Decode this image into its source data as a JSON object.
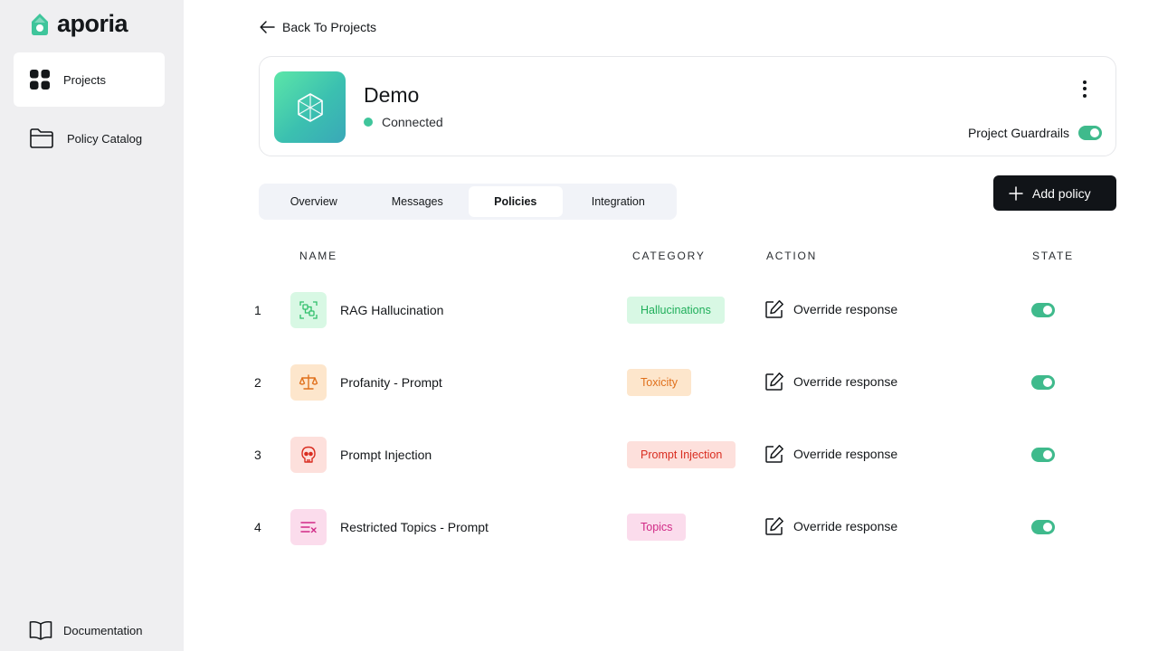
{
  "sidebar": {
    "logo_text": "aporia",
    "items": [
      {
        "label": "Projects",
        "icon": "grid-icon",
        "active": true
      },
      {
        "label": "Policy Catalog",
        "icon": "folder-icon",
        "active": false
      }
    ],
    "footer_item": {
      "label": "Documentation",
      "icon": "book-icon"
    }
  },
  "header": {
    "back_label": "Back To Projects"
  },
  "project": {
    "name": "Demo",
    "status": "Connected",
    "status_color": "#3fc59b",
    "guardrails_label": "Project Guardrails",
    "guardrails_enabled": true
  },
  "tabs": [
    {
      "label": "Overview",
      "active": false
    },
    {
      "label": "Messages",
      "active": false
    },
    {
      "label": "Policies",
      "active": true
    },
    {
      "label": "Integration",
      "active": false
    }
  ],
  "add_policy_label": "Add policy",
  "table": {
    "columns": [
      "NAME",
      "CATEGORY",
      "ACTION",
      "STATE"
    ],
    "rows": [
      {
        "num": "1",
        "name": "RAG Hallucination",
        "icon": "scan-icon",
        "category": "Hallucinations",
        "action": "Override response",
        "enabled": true
      },
      {
        "num": "2",
        "name": "Profanity - Prompt",
        "icon": "scale-icon",
        "category": "Toxicity",
        "action": "Override response",
        "enabled": true
      },
      {
        "num": "3",
        "name": "Prompt Injection",
        "icon": "skull-icon",
        "category": "Prompt Injection",
        "action": "Override response",
        "enabled": true
      },
      {
        "num": "4",
        "name": "Restricted Topics - Prompt",
        "icon": "list-x-icon",
        "category": "Topics",
        "action": "Override response",
        "enabled": true
      }
    ]
  },
  "colors": {
    "accent": "#3fba8c",
    "hallucinations_bg": "#d8f8e4",
    "hallucinations_fg": "#1fae5a",
    "toxicity_bg": "#fde6cc",
    "toxicity_fg": "#e0701c",
    "injection_bg": "#fde0dc",
    "injection_fg": "#d92d20",
    "topics_bg": "#fbdcec",
    "topics_fg": "#d12a86"
  }
}
